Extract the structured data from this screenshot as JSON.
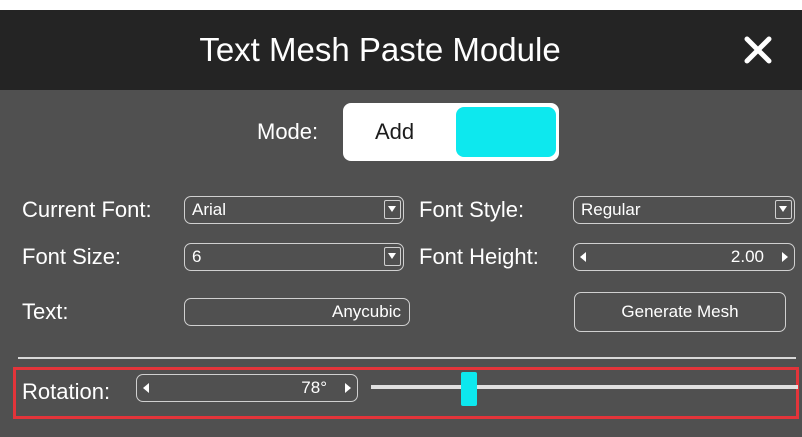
{
  "window": {
    "title": "Text Mesh Paste Module",
    "close_icon": "close-icon"
  },
  "mode": {
    "label": "Mode:",
    "value": "Add",
    "swatch_color": "#0de8ee"
  },
  "current_font": {
    "label": "Current Font:",
    "value": "Arial"
  },
  "font_style": {
    "label": "Font Style:",
    "value": "Regular"
  },
  "font_size": {
    "label": "Font Size:",
    "value": "6"
  },
  "font_height": {
    "label": "Font Height:",
    "value": "2.00"
  },
  "text": {
    "label": "Text:",
    "value": "Anycubic"
  },
  "generate_button": {
    "label": "Generate Mesh"
  },
  "rotation": {
    "label": "Rotation:",
    "value": "78°",
    "slider_fraction": 0.23,
    "thumb_color": "#0de8ee",
    "highlight_color": "#e3343a"
  }
}
